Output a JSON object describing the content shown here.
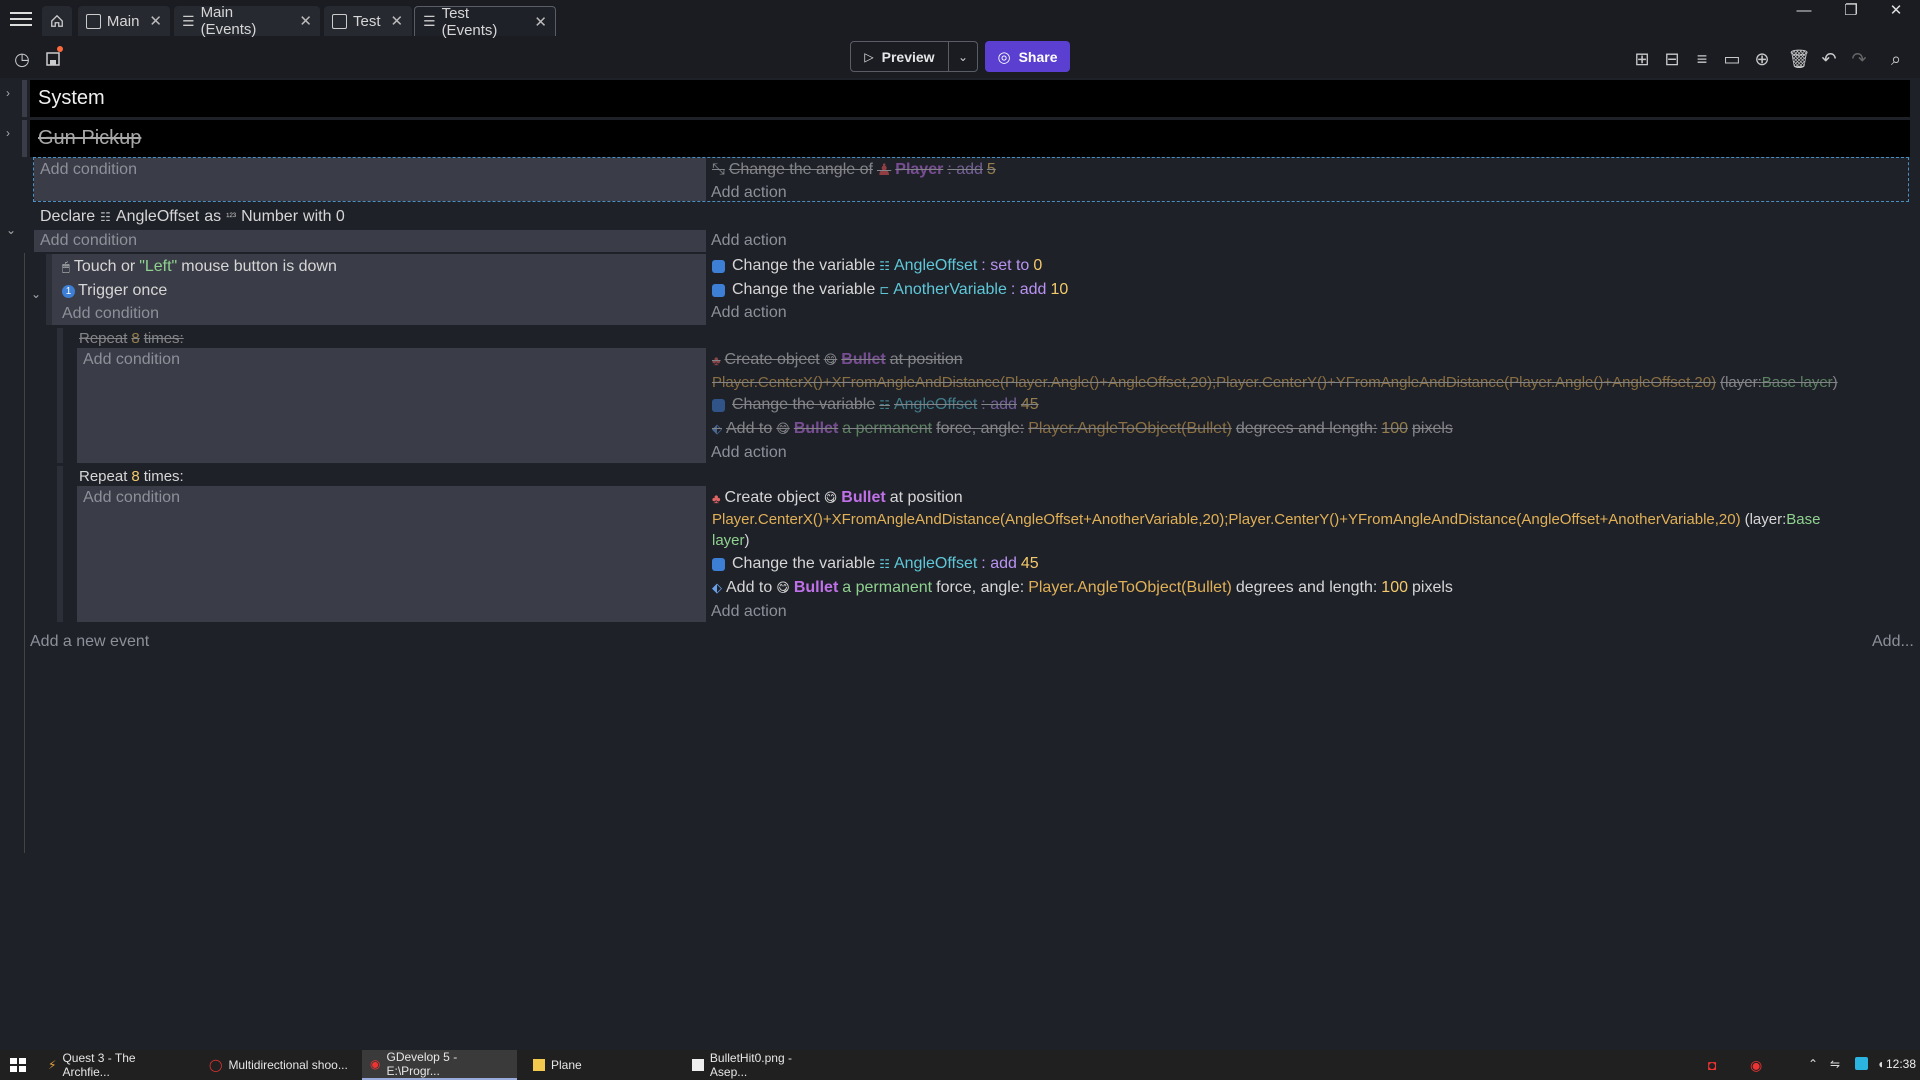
{
  "tabs": [
    {
      "label": "Main"
    },
    {
      "label": "Main (Events)"
    },
    {
      "label": "Test"
    },
    {
      "label": "Test (Events)"
    }
  ],
  "toolbar": {
    "preview_label": "Preview",
    "share_label": "Share"
  },
  "events": {
    "system_header": "System",
    "gun_pickup_header": "Gun Pickup",
    "add_condition": "Add condition",
    "add_action": "Add action",
    "gun_action": {
      "text1": "Change the angle of",
      "object": "Player",
      "op": ": add",
      "value": "5"
    },
    "declare": {
      "prefix": "Declare",
      "var": "AngleOffset",
      "as": "as",
      "type": "Number",
      "with": "with 0"
    },
    "cond1": {
      "prefix": "Touch or",
      "button": "\"Left\"",
      "suffix": "mouse button is down"
    },
    "cond2": "Trigger once",
    "act1": {
      "text": "Change the variable",
      "var": "AngleOffset",
      "op": ": set to",
      "val": "0"
    },
    "act2": {
      "text": "Change the variable",
      "var": "AnotherVariable",
      "op": ": add",
      "val": "10"
    },
    "repeat1": {
      "prefix": "Repeat",
      "count": "8",
      "suffix": "times:"
    },
    "r1_create": {
      "text": "Create object",
      "obj": "Bullet",
      "suffix": "at position"
    },
    "r1_expr": "Player.CenterX()+XFromAngleAndDistance(Player.Angle()+AngleOffset,20);Player.CenterY()+YFromAngleAndDistance(Player.Angle()+AngleOffset,20)",
    "r1_layer_pre": "(layer:",
    "r1_layer": "Base layer",
    "r1_layer_post": ")",
    "r1_var": {
      "text": "Change the variable",
      "var": "AngleOffset",
      "op": ": add",
      "val": "45"
    },
    "r1_force": {
      "text": "Add to",
      "obj": "Bullet",
      "perm": "a permanent",
      "mid": "force, angle:",
      "expr": "Player.AngleToObject(Bullet)",
      "mid2": "degrees and length:",
      "val": "100",
      "unit": "pixels"
    },
    "repeat2": {
      "prefix": "Repeat",
      "count": "8",
      "suffix": "times:"
    },
    "r2_create": {
      "text": "Create object",
      "obj": "Bullet",
      "suffix": "at position"
    },
    "r2_expr": "Player.CenterX()+XFromAngleAndDistance(AngleOffset+AnotherVariable,20);Player.CenterY()+YFromAngleAndDistance(AngleOffset+AnotherVariable,20)",
    "r2_layer_pre": "(layer:",
    "r2_layer1": "Base",
    "r2_layer2": "layer",
    "r2_layer_post": ")",
    "r2_var": {
      "text": "Change the variable",
      "var": "AngleOffset",
      "op": ": add",
      "val": "45"
    },
    "r2_force": {
      "text": "Add to",
      "obj": "Bullet",
      "perm": "a permanent",
      "mid": "force, angle:",
      "expr": "Player.AngleToObject(Bullet)",
      "mid2": "degrees and length:",
      "val": "100",
      "unit": "pixels"
    },
    "add_new_event": "Add a new event",
    "add_more": "Add..."
  },
  "taskbar": {
    "items": [
      {
        "label": "Quest 3 - The Archfie..."
      },
      {
        "label": "Multidirectional shoo..."
      },
      {
        "label": "GDevelop 5 - E:\\Progr..."
      },
      {
        "label": "Plane"
      },
      {
        "label": "BulletHit0.png - Asep..."
      }
    ],
    "time": "12:38"
  }
}
